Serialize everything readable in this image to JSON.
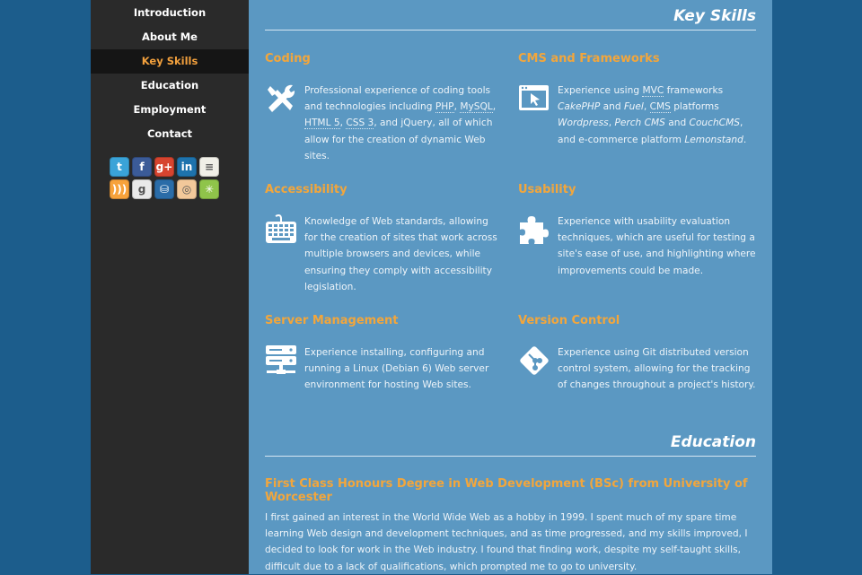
{
  "nav": [
    {
      "label": "Introduction",
      "active": false
    },
    {
      "label": "About Me",
      "active": false
    },
    {
      "label": "Key Skills",
      "active": true
    },
    {
      "label": "Education",
      "active": false
    },
    {
      "label": "Employment",
      "active": false
    },
    {
      "label": "Contact",
      "active": false
    }
  ],
  "social_row1": [
    {
      "name": "twitter",
      "glyph": "t",
      "color": "#3aa3d8"
    },
    {
      "name": "facebook",
      "glyph": "f",
      "color": "#3b5b98"
    },
    {
      "name": "google-plus",
      "glyph": "g+",
      "color": "#d6442f"
    },
    {
      "name": "linkedin",
      "glyph": "in",
      "color": "#1e73ad"
    },
    {
      "name": "stackoverflow",
      "glyph": "≡",
      "color": "#f0efe7"
    }
  ],
  "social_row2": [
    {
      "name": "rss",
      "glyph": ")))",
      "color": "#f7a23b"
    },
    {
      "name": "github",
      "glyph": "g",
      "color": "#e9e9e9"
    },
    {
      "name": "bitbucket",
      "glyph": "⛁",
      "color": "#2a6ca8"
    },
    {
      "name": "openhub",
      "glyph": "◎",
      "color": "#f2c89a"
    },
    {
      "name": "lime",
      "glyph": "✳",
      "color": "#8fc44a"
    }
  ],
  "key_skills": {
    "heading": "Key Skills",
    "coding": {
      "title": "Coding",
      "t1": "Professional experience of coding tools and technologies including ",
      "php": "PHP",
      "sep1": ", ",
      "mysql": "MySQL",
      "sep2": ", ",
      "html5": "HTML 5",
      "sep3": ", ",
      "css3": "CSS 3",
      "t2": ", and jQuery, all of which allow for the creation of dynamic Web sites."
    },
    "cms": {
      "title": "CMS and Frameworks",
      "t1": "Experience using ",
      "mvc": "MVC",
      "t2": " frameworks ",
      "cakephp": "CakePHP",
      "t3": " and ",
      "fuel": "Fuel",
      "t4": ", ",
      "cms_abbr": "CMS",
      "t5": " platforms ",
      "wordpress": "Wordpress",
      "t6": ", ",
      "perch": "Perch CMS",
      "t7": " and ",
      "couch": "CouchCMS",
      "t8": ", and e-commerce platform ",
      "lemonstand": "Lemonstand",
      "t9": "."
    },
    "accessibility": {
      "title": "Accessibility",
      "text": "Knowledge of Web standards, allowing for the creation of sites that work across multiple browsers and devices, while ensuring they comply with accessibility legislation."
    },
    "usability": {
      "title": "Usability",
      "text": "Experience with usability evaluation techniques, which are useful for testing a site's ease of use, and highlighting where improvements could be made."
    },
    "server": {
      "title": "Server Management",
      "text": "Experience installing, configuring and running a Linux (Debian 6) Web server environment for hosting Web sites."
    },
    "version": {
      "title": "Version Control",
      "text": "Experience using Git distributed version control system, allowing for the tracking of changes throughout a project's history."
    }
  },
  "education": {
    "heading": "Education",
    "degree": "First Class Honours Degree in Web Development (BSc) from University of Worcester",
    "text": "I first gained an interest in the World Wide Web as a hobby in 1999. I spent much of my spare time learning Web design and development techniques, and as time progressed, and my skills improved, I decided to look for work in the Web industry. I found that finding work, despite my self-taught skills, difficult due to a lack of qualifications, which prompted me to go to university."
  }
}
